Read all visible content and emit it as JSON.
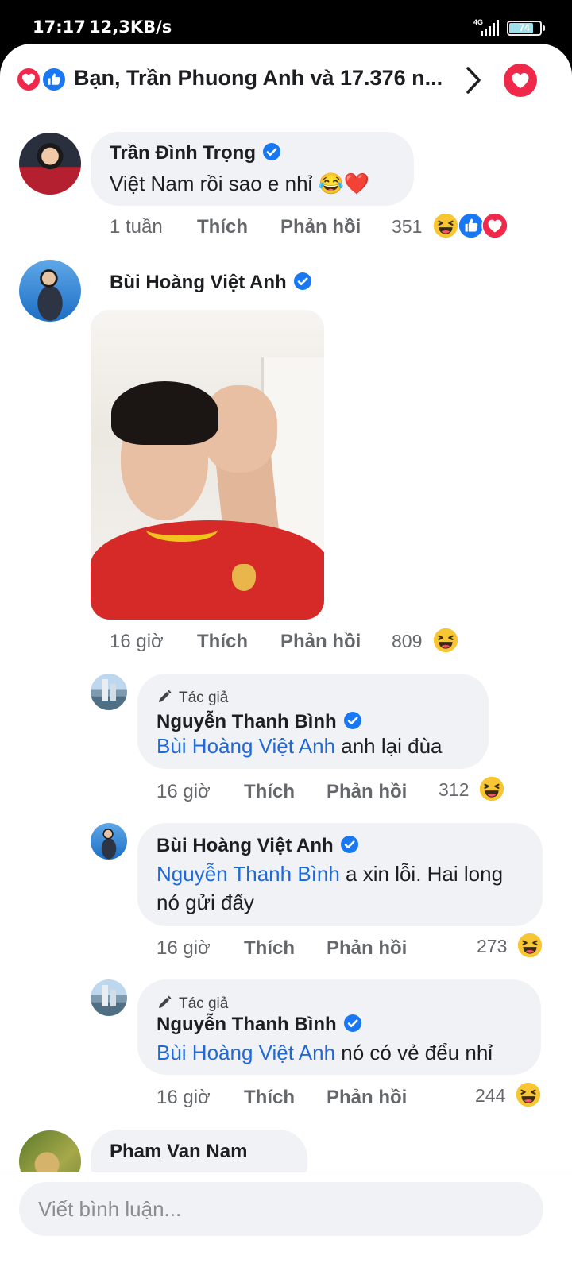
{
  "status_bar": {
    "time": "17:17",
    "speed": "12,3KB/s",
    "network": "4G",
    "battery": "74"
  },
  "header": {
    "reactions_text": "Bạn, Trần Phuong Anh và 17.376 n..."
  },
  "comments": [
    {
      "name": "Trần Đình Trọng",
      "text": "Việt Nam rồi sao e nhỉ 😂❤️",
      "time": "1 tuần",
      "like": "Thích",
      "reply": "Phản hồi",
      "count": "351"
    },
    {
      "name": "Bùi Hoàng Việt Anh",
      "time": "16 giờ",
      "like": "Thích",
      "reply": "Phản hồi",
      "count": "809"
    }
  ],
  "replies": [
    {
      "tag": "Tác giả",
      "name": "Nguyễn Thanh Bình",
      "mention": "Bùi Hoàng Việt Anh",
      "text": "anh lại đùa",
      "time": "16 giờ",
      "like": "Thích",
      "reply": "Phản hồi",
      "count": "312"
    },
    {
      "name": "Bùi Hoàng Việt Anh",
      "mention": "Nguyễn Thanh Bình",
      "text": "a xin lỗi. Hai long nó gửi đấy",
      "time": "16 giờ",
      "like": "Thích",
      "reply": "Phản hồi",
      "count": "273"
    },
    {
      "tag": "Tác giả",
      "name": "Nguyễn Thanh Bình",
      "mention": "Bùi Hoàng Việt Anh",
      "text": "nó có vẻ đểu nhỉ",
      "time": "16 giờ",
      "like": "Thích",
      "reply": "Phản hồi",
      "count": "244"
    }
  ],
  "partial_comment": {
    "name": "Pham Van Nam"
  },
  "composer": {
    "placeholder": "Viết bình luận..."
  },
  "colors": {
    "love": "#f0284a",
    "like": "#1877f2",
    "haha": "#f7c632",
    "mention": "#1f6ad8",
    "bubble": "#f0f2f5",
    "verified": "#1877f2"
  }
}
